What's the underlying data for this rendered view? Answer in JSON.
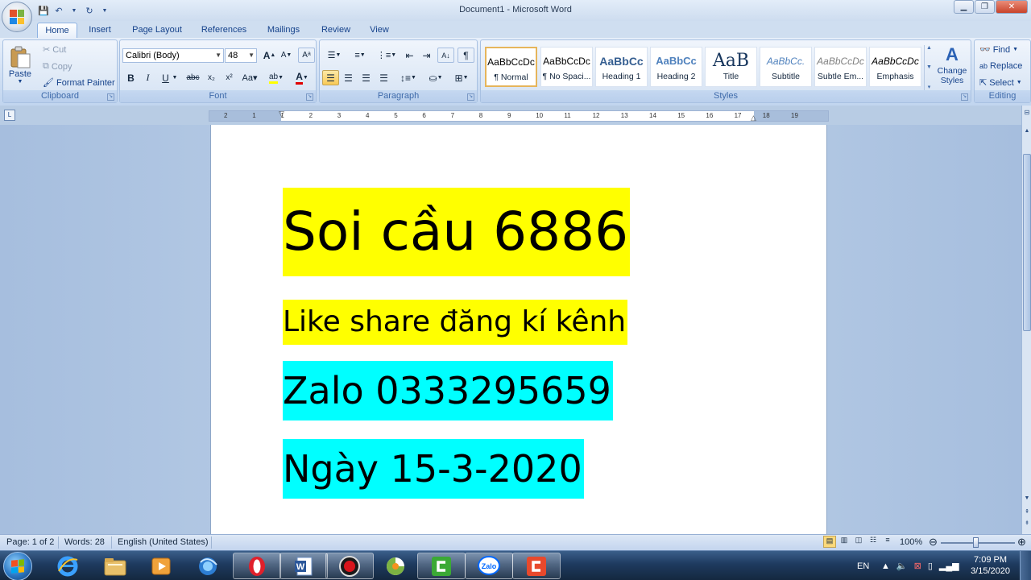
{
  "window": {
    "title": "Document1 - Microsoft Word"
  },
  "tabs": [
    "Home",
    "Insert",
    "Page Layout",
    "References",
    "Mailings",
    "Review",
    "View"
  ],
  "clipboard": {
    "paste": "Paste",
    "cut": "Cut",
    "copy": "Copy",
    "format_painter": "Format Painter",
    "group": "Clipboard"
  },
  "font": {
    "name": "Calibri (Body)",
    "size": "48",
    "group": "Font"
  },
  "paragraph": {
    "group": "Paragraph"
  },
  "styles": {
    "group": "Styles",
    "items": [
      {
        "sample": "AaBbCcDc",
        "name": "¶ Normal"
      },
      {
        "sample": "AaBbCcDc",
        "name": "¶ No Spaci..."
      },
      {
        "sample": "AaBbCc",
        "name": "Heading 1"
      },
      {
        "sample": "AaBbCc",
        "name": "Heading 2"
      },
      {
        "sample": "AaB",
        "name": "Title"
      },
      {
        "sample": "AaBbCc.",
        "name": "Subtitle"
      },
      {
        "sample": "AaBbCcDc",
        "name": "Subtle Em..."
      },
      {
        "sample": "AaBbCcDc",
        "name": "Emphasis"
      }
    ],
    "change_styles": "Change Styles"
  },
  "editing": {
    "find": "Find",
    "replace": "Replace",
    "select": "Select",
    "group": "Editing"
  },
  "ruler": {
    "labels": [
      "2",
      "1",
      "1",
      "2",
      "3",
      "4",
      "5",
      "6",
      "7",
      "8",
      "9",
      "10",
      "11",
      "12",
      "13",
      "14",
      "15",
      "16",
      "17",
      "18",
      "19"
    ]
  },
  "document": {
    "lines": [
      {
        "text": "Soi cầu 6886",
        "highlight": "#ffff00"
      },
      {
        "text": "Like share đăng kí kênh",
        "highlight": "#ffff00"
      },
      {
        "text": "Zalo 0333295659",
        "highlight": "#00ffff"
      },
      {
        "text": "Ngày 15-3-2020",
        "highlight": "#00ffff"
      }
    ]
  },
  "status": {
    "page": "Page: 1 of 2",
    "words": "Words: 28",
    "language": "English (United States)",
    "zoom": "100%"
  },
  "taskbar": {
    "apps": [
      "internet-explorer",
      "file-explorer",
      "media-player",
      "browser",
      "opera",
      "word",
      "recorder",
      "coccoc",
      "camtasia",
      "zalo",
      "camtasia-recorder"
    ],
    "lang": "EN",
    "time": "7:09 PM",
    "date": "3/15/2020"
  }
}
